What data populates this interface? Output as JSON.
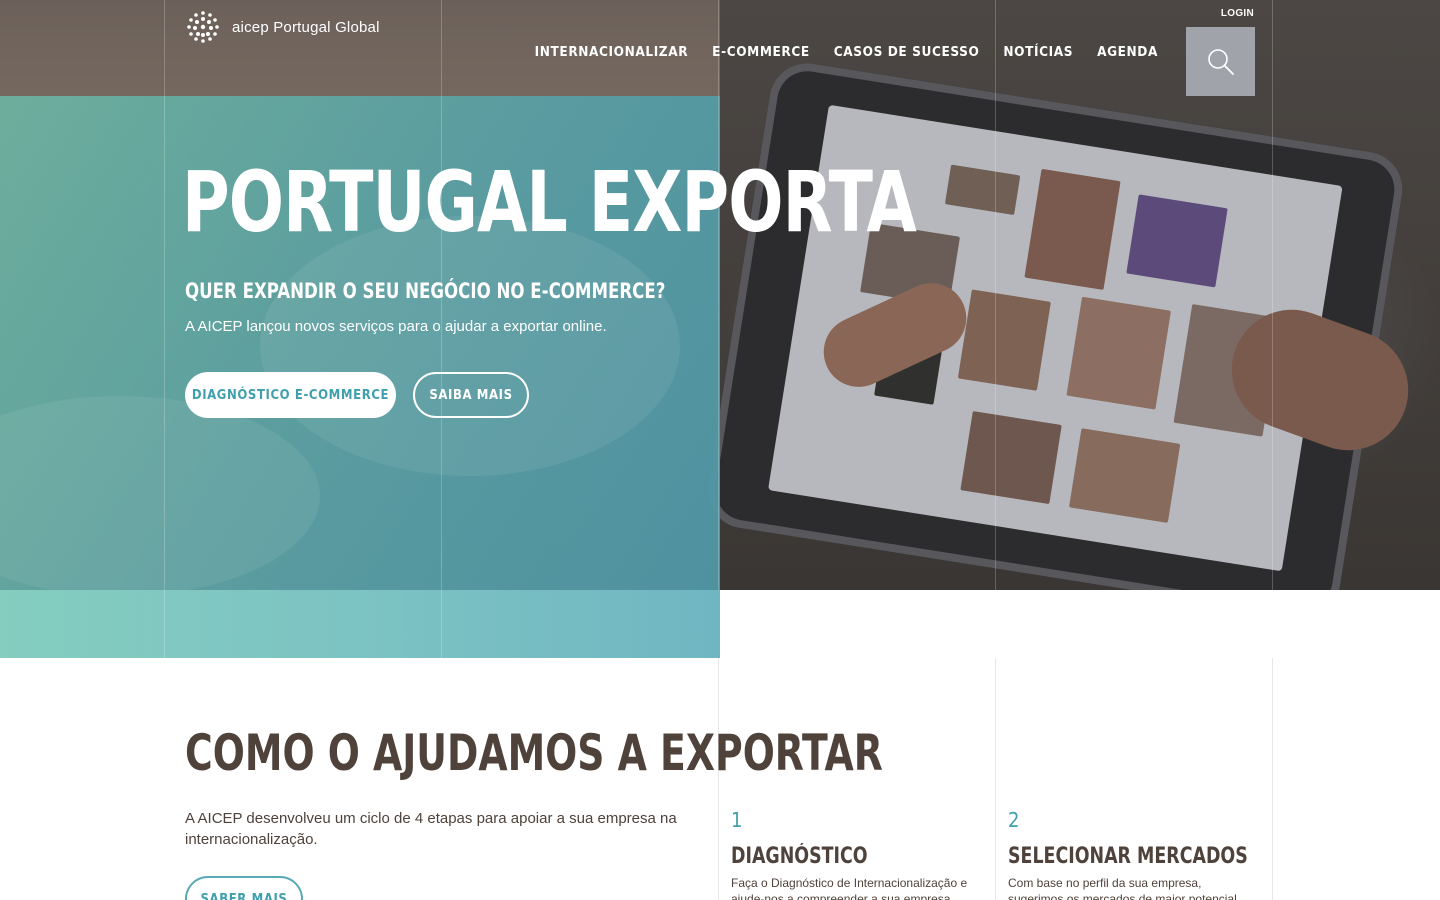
{
  "brand": {
    "name": "aicep Portugal Global"
  },
  "header": {
    "login_label": "LOGIN",
    "nav": [
      {
        "label": "INTERNACIONALIZAR"
      },
      {
        "label": "E-COMMERCE"
      },
      {
        "label": "CASOS DE SUCESSO"
      },
      {
        "label": "NOTÍCIAS"
      },
      {
        "label": "AGENDA"
      }
    ],
    "search_icon": "search-icon"
  },
  "hero": {
    "title": "PORTUGAL EXPORTA",
    "subtitle": "QUER EXPANDIR O SEU NEGÓCIO NO E-COMMERCE?",
    "text": "A AICEP lançou novos serviços para o ajudar a exportar online.",
    "primary_button": "DIAGNÓSTICO E-COMMERCE",
    "secondary_button": "SAIBA MAIS"
  },
  "how": {
    "title": "COMO O AJUDAMOS A EXPORTAR",
    "text": "A AICEP desenvolveu um ciclo de 4 etapas para apoiar a sua empresa na internacionalização.",
    "button": "SABER MAIS",
    "steps": [
      {
        "number": "1",
        "title": "DIAGNÓSTICO",
        "text": "Faça o Diagnóstico de Internacionalização e ajude-nos a compreender a sua empresa, para o"
      },
      {
        "number": "2",
        "title": "SELECIONAR MERCADOS",
        "text": "Com base no perfil da sua empresa, sugerimos os mercados de maior potencial para as suas"
      }
    ]
  },
  "colors": {
    "teal": "#5aa8ad",
    "teal_light": "#84cdbf",
    "accent_text": "#3f9fae",
    "heading": "#4f423b"
  }
}
